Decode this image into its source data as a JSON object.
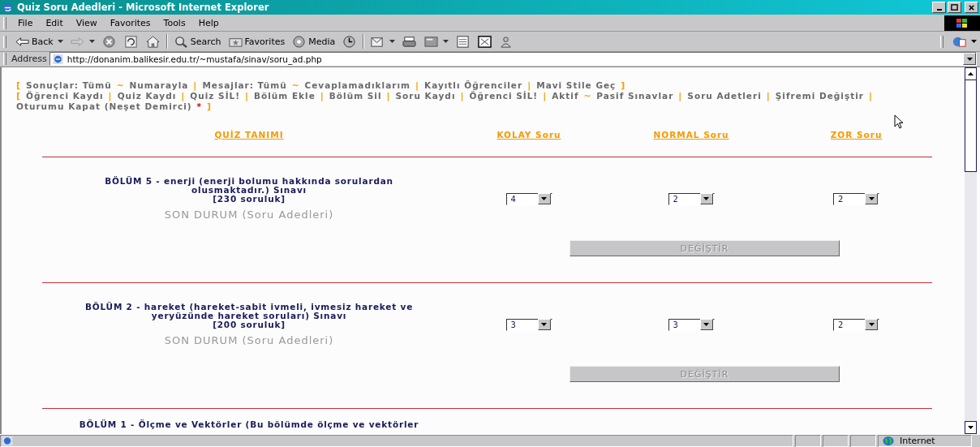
{
  "window": {
    "title": "Quiz Soru Adedleri - Microsoft Internet Explorer"
  },
  "menu": [
    "File",
    "Edit",
    "View",
    "Favorites",
    "Tools",
    "Help"
  ],
  "toolbar": [
    {
      "kind": "back",
      "label": "Back",
      "dropdown": true
    },
    {
      "kind": "forward",
      "dropdown": true
    },
    {
      "kind": "stop",
      "dropdown": false
    },
    {
      "kind": "refresh",
      "dropdown": false
    },
    {
      "kind": "home",
      "dropdown": false
    },
    {
      "kind": "separator"
    },
    {
      "kind": "search",
      "label": "Search",
      "dropdown": false
    },
    {
      "kind": "favorites",
      "label": "Favorites",
      "dropdown": false
    },
    {
      "kind": "media",
      "label": "Media",
      "dropdown": false
    },
    {
      "kind": "history",
      "dropdown": false
    },
    {
      "kind": "separator"
    },
    {
      "kind": "mail",
      "dropdown": true
    },
    {
      "kind": "print",
      "dropdown": false
    },
    {
      "kind": "edit",
      "dropdown": true
    },
    {
      "kind": "document",
      "dropdown": false
    },
    {
      "kind": "research",
      "dropdown": false
    },
    {
      "kind": "messenger",
      "dropdown": false
    }
  ],
  "toolbar_extra": {
    "kind": "acrobat",
    "dropdown": true
  },
  "address": {
    "label": "Address",
    "url": "http://donanim.balikesir.edu.tr/~mustafa/sinav/soru_ad.php"
  },
  "nav": {
    "lines": [
      {
        "items": [
          {
            "kind": "bracket",
            "text": "["
          },
          {
            "kind": "link",
            "text": "Sonuçlar: Tümü"
          },
          {
            "kind": "tilde",
            "text": "~"
          },
          {
            "kind": "link",
            "text": "Numarayla"
          },
          {
            "kind": "bar",
            "text": "|"
          },
          {
            "kind": "link",
            "text": "Mesajlar: Tümü"
          },
          {
            "kind": "tilde",
            "text": "~"
          },
          {
            "kind": "link",
            "text": "Cevaplamadıklarım"
          },
          {
            "kind": "bar",
            "text": "|"
          },
          {
            "kind": "link",
            "text": "Kayıtlı Öğrenciler"
          },
          {
            "kind": "bar",
            "text": "|"
          },
          {
            "kind": "link",
            "text": "Mavi Stile Geç"
          },
          {
            "kind": "bracket",
            "text": "]"
          }
        ]
      },
      {
        "items": [
          {
            "kind": "bracket",
            "text": "["
          },
          {
            "kind": "link",
            "text": "Öğrenci Kaydı"
          },
          {
            "kind": "bar",
            "text": "|"
          },
          {
            "kind": "link",
            "text": "Quiz Kaydı"
          },
          {
            "kind": "bar",
            "text": "|"
          },
          {
            "kind": "link",
            "text": "Quiz SİL!"
          },
          {
            "kind": "bar",
            "text": "|"
          },
          {
            "kind": "link",
            "text": "Bölüm Ekle"
          },
          {
            "kind": "bar",
            "text": "|"
          },
          {
            "kind": "link",
            "text": "Bölüm Sil"
          },
          {
            "kind": "bar",
            "text": "|"
          },
          {
            "kind": "link",
            "text": "Soru Kaydı"
          },
          {
            "kind": "bar",
            "text": "|"
          },
          {
            "kind": "link",
            "text": "Öğrenci SİL!"
          },
          {
            "kind": "bar",
            "text": "|"
          },
          {
            "kind": "link",
            "text": "Aktif"
          },
          {
            "kind": "tilde",
            "text": "~"
          },
          {
            "kind": "link",
            "text": "Pasif Sınavlar"
          },
          {
            "kind": "bar",
            "text": "|"
          },
          {
            "kind": "link",
            "text": "Soru Adetleri"
          },
          {
            "kind": "bar",
            "text": "|"
          },
          {
            "kind": "link",
            "text": "Şifremi Değiştir"
          },
          {
            "kind": "bar",
            "text": "|"
          },
          {
            "kind": "link",
            "text": "Oturumu Kapat (Neşet Demirci)"
          },
          {
            "kind": "star",
            "text": "*"
          },
          {
            "kind": "bracket",
            "text": "]"
          }
        ]
      }
    ]
  },
  "columns": [
    "QUİZ TANIMI",
    "KOLAY Soru",
    "NORMAL Soru",
    "ZOR Soru"
  ],
  "sections": [
    {
      "title": "BÖLÜM 5 - enerji (enerji bolumu hakkında sorulardan olusmaktadır.) Sınavı",
      "size": "[230 soruluk]",
      "status": "SON DURUM (Soru Adedleri)",
      "selects": [
        "4",
        "2",
        "2"
      ],
      "button": {
        "label": "DEĞİŞTİR",
        "disabled": true
      }
    },
    {
      "title": "BÖLÜM 2 - hareket (hareket-sabit ivmeli, ivmesiz hareket ve yeryüzünde hareket soruları) Sınavı",
      "size": "[200 soruluk]",
      "status": "SON DURUM (Soru Adedleri)",
      "selects": [
        "3",
        "3",
        "2"
      ],
      "button": {
        "label": "DEĞİŞTİR",
        "disabled": true
      }
    }
  ],
  "cut_section": {
    "title": "BÖLÜM 1 - Ölçme ve Vektörler (Bu bölümde ölçme ve vektörler"
  },
  "status_bar": {
    "zone": "Internet"
  }
}
